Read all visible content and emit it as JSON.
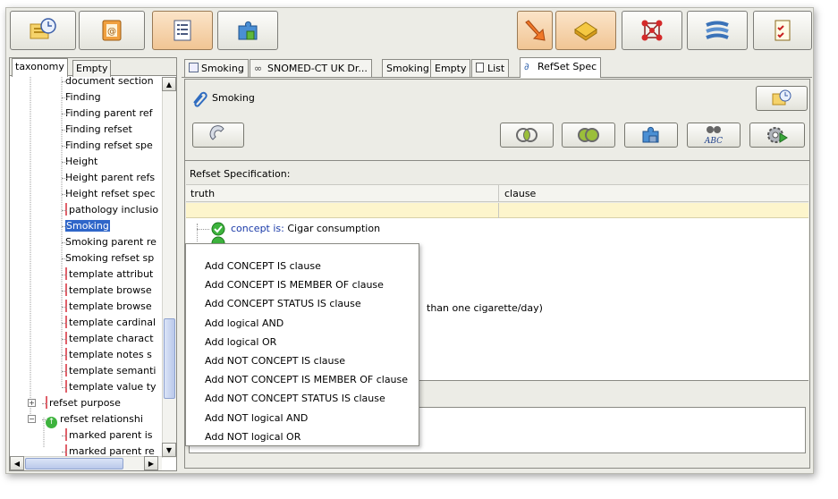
{
  "left_panel": {
    "tabs": [
      "taxonomy",
      "Empty"
    ],
    "tree_items": [
      "document section",
      "Finding",
      "Finding parent ref",
      "Finding refset",
      "Finding refset spe",
      "Height",
      "Height parent refs",
      "Height refset spec",
      "pathology inclusio",
      "Smoking",
      "Smoking parent re",
      "Smoking refset sp",
      "template attribut",
      "template browse",
      "template browse",
      "template cardinal",
      "template charact",
      "template notes s",
      "template semanti",
      "template value ty",
      "refset purpose",
      "refset relationshi",
      "marked parent is",
      "marked parent re"
    ],
    "selected_item": "Smoking"
  },
  "editor_tabs": [
    "Smoking",
    "SNOMED-CT UK Dr...",
    "Smoking",
    "Empty",
    "List",
    "RefSet Spec"
  ],
  "editor": {
    "title": "Smoking",
    "section_label": "Refset Specification:",
    "columns": [
      "truth",
      "clause"
    ],
    "tree_row": {
      "label": "concept is:",
      "value": "Cigar consumption"
    },
    "partial_text": "than one cigarette/day)"
  },
  "context_menu": [
    "Add CONCEPT IS clause",
    "Add CONCEPT IS MEMBER OF clause",
    "Add CONCEPT STATUS IS clause",
    "Add logical AND",
    "Add logical OR",
    "Add NOT CONCEPT IS clause",
    "Add NOT CONCEPT IS MEMBER OF clause",
    "Add NOT CONCEPT STATUS IS clause",
    "Add NOT logical AND",
    "Add NOT logical OR"
  ],
  "icons": {
    "toolbar": [
      "history-icon",
      "address-book-icon",
      "list-view-icon",
      "puzzle-icon",
      "arrow-down-icon",
      "drawer-icon",
      "molecule-icon",
      "lines-icon",
      "checklist-icon"
    ],
    "editor": [
      "phone-icon",
      "venn-intersect-icon",
      "venn-union-icon",
      "puzzle-icon",
      "abc-binoculars-icon",
      "gear-play-icon"
    ]
  },
  "colors": {
    "selection": "#2f66c9",
    "highlight_row": "#fdf5cc",
    "accent_orange": "#f0a24a"
  }
}
